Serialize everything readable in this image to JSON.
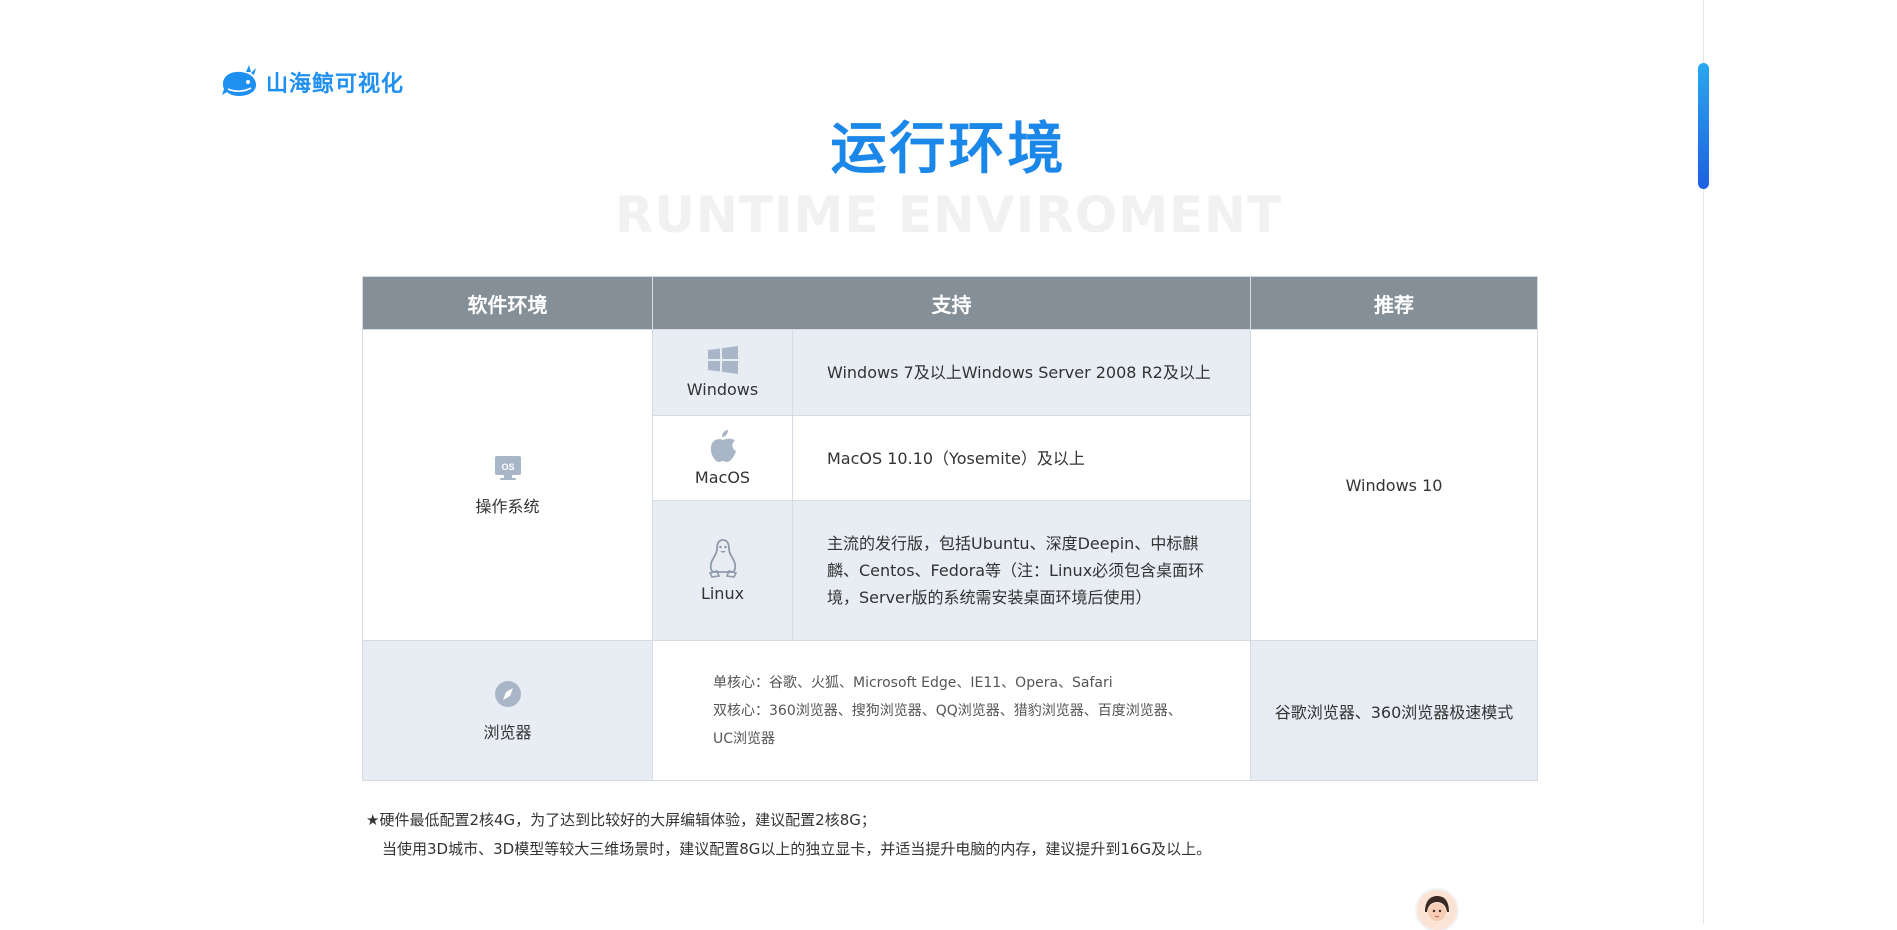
{
  "brand": {
    "name": "山海鲸可视化",
    "color": "#1f8ff0"
  },
  "title": {
    "main": "运行环境",
    "sub": "RUNTIME ENVIROMENT"
  },
  "table": {
    "headers": [
      "软件环境",
      "支持",
      "推荐"
    ],
    "os": {
      "category": "操作系统",
      "category_icon": "monitor-os-icon",
      "recommend": "Windows 10",
      "rows": [
        {
          "icon": "windows-logo-icon",
          "name": "Windows",
          "desc": "Windows 7及以上Windows Server 2008 R2及以上"
        },
        {
          "icon": "apple-logo-icon",
          "name": "MacOS",
          "desc": "MacOS 10.10（Yosemite）及以上"
        },
        {
          "icon": "linux-penguin-icon",
          "name": "Linux",
          "desc": "主流的发行版，包括Ubuntu、深度Deepin、中标麒麟、Centos、Fedora等（注：Linux必须包含桌面环境，Server版的系统需安装桌面环境后使用）"
        }
      ]
    },
    "browser": {
      "category": "浏览器",
      "category_icon": "compass-icon",
      "single_core": "单核心：谷歌、火狐、Microsoft Edge、IE11、Opera、Safari",
      "dual_core": "双核心：360浏览器、搜狗浏览器、QQ浏览器、猎豹浏览器、百度浏览器、UC浏览器",
      "recommend": "谷歌浏览器、360浏览器极速模式"
    }
  },
  "notes": {
    "line1": "★硬件最低配置2核4G，为了达到比较好的大屏编辑体验，建议配置2核8G；",
    "line2": "当使用3D城市、3D模型等较大三维场景时，建议配置8G以上的独立显卡，并适当提升电脑的内存，建议提升到16G及以上。"
  },
  "colors": {
    "header_bg": "#858f98",
    "row_shade": "#e8ecf3",
    "title": "#1b87e8"
  }
}
